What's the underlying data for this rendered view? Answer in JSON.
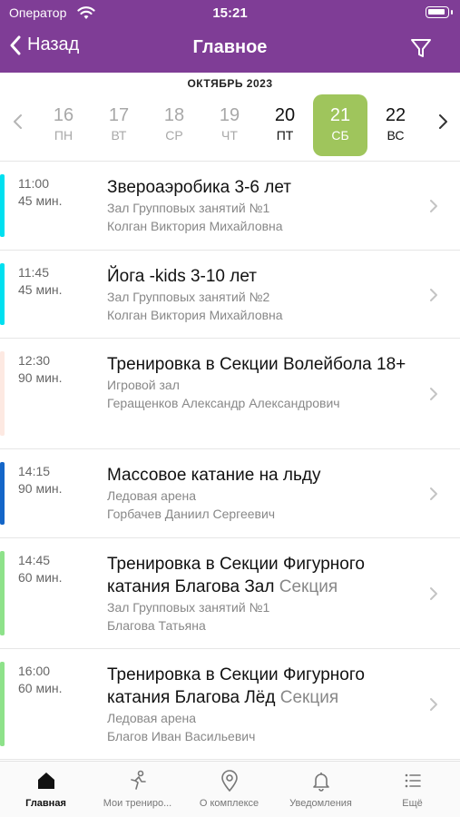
{
  "status_bar": {
    "carrier": "Оператор",
    "time": "15:21"
  },
  "nav": {
    "back_label": "Назад",
    "title": "Главное"
  },
  "calendar": {
    "month": "ОКТЯБРЬ 2023",
    "days": [
      {
        "num": "16",
        "dow": "ПН",
        "state": "past"
      },
      {
        "num": "17",
        "dow": "ВТ",
        "state": "past"
      },
      {
        "num": "18",
        "dow": "СР",
        "state": "past"
      },
      {
        "num": "19",
        "dow": "ЧТ",
        "state": "past"
      },
      {
        "num": "20",
        "dow": "ПТ",
        "state": "normal"
      },
      {
        "num": "21",
        "dow": "СБ",
        "state": "selected"
      },
      {
        "num": "22",
        "dow": "ВС",
        "state": "normal"
      }
    ],
    "selected_color": "#9fc55c"
  },
  "schedule": [
    {
      "time": "11:00",
      "duration": "45 мин.",
      "name": "Звероаэробика 3-6 лет",
      "tag": "",
      "hall": "Зал Групповых занятий №1",
      "trainer": "Колган Виктория Михайловна",
      "color": "#00e0f0"
    },
    {
      "time": "11:45",
      "duration": "45 мин.",
      "name": "Йога -kids 3-10 лет",
      "tag": "",
      "hall": "Зал Групповых занятий №2",
      "trainer": "Колган Виктория Михайловна",
      "color": "#00e0f0"
    },
    {
      "time": "12:30",
      "duration": "90 мин.",
      "name": "Тренировка в Секции Волейбола  18+",
      "tag": "",
      "hall": "Игровой зал",
      "trainer": "Геращенков  Александр Александрович",
      "color": "#fde9e2"
    },
    {
      "time": "14:15",
      "duration": "90 мин.",
      "name": "Массовое катание на льду",
      "tag": "",
      "hall": "Ледовая арена",
      "trainer": "Горбачев  Даниил Сергеевич",
      "color": "#1466c8"
    },
    {
      "time": "14:45",
      "duration": "60 мин.",
      "name": "Тренировка в Секции Фигурного катания Благова Зал",
      "tag": "Секция",
      "hall": "Зал Групповых занятий №1",
      "trainer": "Благова Татьяна",
      "color": "#8ee28a"
    },
    {
      "time": "16:00",
      "duration": "60 мин.",
      "name": "Тренировка в Секции Фигурного катания Благова Лёд",
      "tag": "Секция",
      "hall": "Ледовая арена",
      "trainer": "Благов Иван Васильевич",
      "color": "#8ee28a"
    }
  ],
  "tabbar": {
    "tabs": [
      {
        "label": "Главная",
        "icon": "home-icon",
        "active": true
      },
      {
        "label": "Мои трениро...",
        "icon": "runner-icon",
        "active": false
      },
      {
        "label": "О комплексе",
        "icon": "location-pin-icon",
        "active": false
      },
      {
        "label": "Уведомления",
        "icon": "bell-icon",
        "active": false
      },
      {
        "label": "Ещё",
        "icon": "more-list-icon",
        "active": false
      }
    ]
  },
  "colors": {
    "header": "#7f3d96",
    "accent_green": "#9fc55c"
  }
}
